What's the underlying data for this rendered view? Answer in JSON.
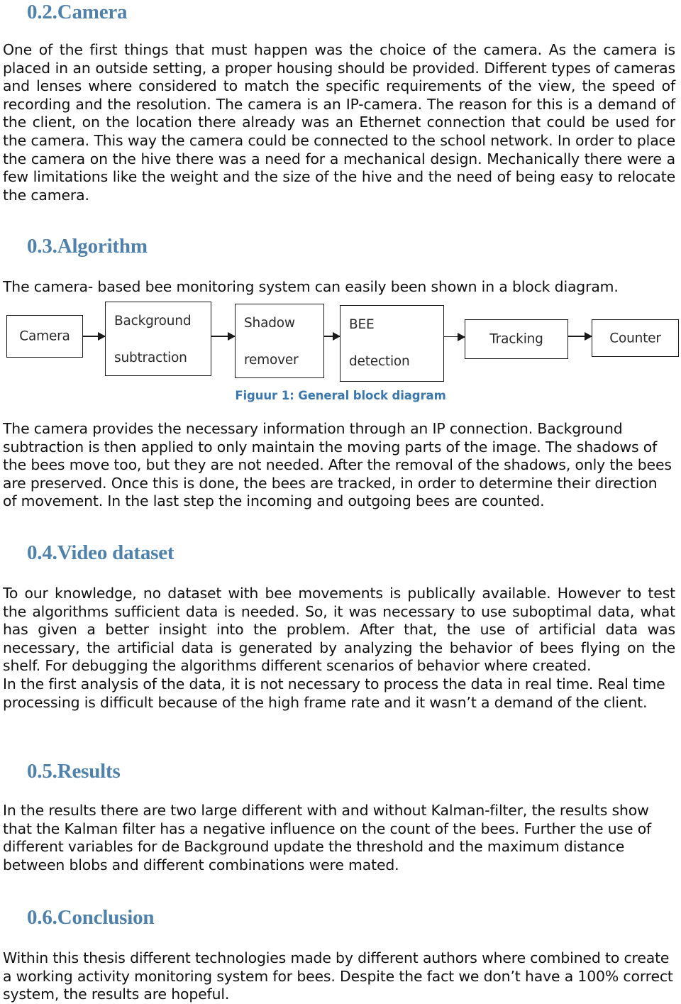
{
  "document": {
    "type": "thesis-report-page",
    "accent_heading_color": "#4f81ab",
    "caption_color": "#3c78ad",
    "body_color": "#111111"
  },
  "sections": [
    {
      "id": "camera",
      "heading": "0.2.Camera",
      "body": "One of the first things that must happen was the choice of the camera. As the camera is placed in an outside setting, a proper housing should be provided. Different types of cameras and lenses where considered to match the specific requirements of the view, the speed of recording and the resolution. The camera is an IP-camera. The reason for this is a demand of the client, on the location there already was an Ethernet connection that could be used for the camera. This way the camera could be connected to the school network. In order to place the camera on the hive there was a need for a mechanical design. Mechanically there were a few limitations like the weight and the size of the hive and the need of being easy to relocate the camera."
    },
    {
      "id": "algorithm",
      "heading": "0.3.Algorithm",
      "intro": "The camera- based bee monitoring system can easily been shown in a block diagram.",
      "body": "The camera provides the necessary information through an IP connection. Background subtraction is then applied to only maintain the moving parts of the image. The shadows of the bees move too, but they are not needed. After the removal of the shadows, only the bees are preserved. Once this is done, the bees are tracked, in order to determine their direction of movement. In the last step the incoming and outgoing bees are counted."
    },
    {
      "id": "video-dataset",
      "heading": "0.4.Video dataset",
      "body": "To our knowledge, no dataset with bee movements is publically available. However to test the algorithms sufficient data is needed. So, it was necessary to use suboptimal data, what has given a better insight into the problem. After that, the use of artificial data was necessary, the artificial data is generated by analyzing the behavior of bees flying on the shelf. For debugging the algorithms different scenarios of behavior where created.",
      "body2": "In the first analysis of the data, it is not necessary to process the data in real time. Real time processing is difficult because of the high frame rate and it wasn’t a demand of the client."
    },
    {
      "id": "results",
      "heading": "0.5.Results",
      "body": "In the results there are two large different with and without Kalman-filter, the results show that the Kalman filter has a negative influence on the count of the bees. Further the use of different variables for de Background update the threshold and the maximum distance between blobs and different combinations were mated."
    },
    {
      "id": "conclusion",
      "heading": "0.6.Conclusion",
      "body": "Within this thesis different technologies made by different authors where combined to create a working activity monitoring system for bees. Despite the fact we don’t have a 100% correct system, the results are hopeful."
    }
  ],
  "figure": {
    "caption": "Figuur 1: General block diagram",
    "blocks": [
      {
        "id": "camera",
        "label": "Camera",
        "line1": "Camera",
        "line2": ""
      },
      {
        "id": "background",
        "label": "Background subtraction",
        "line1": "Background",
        "line2": "subtraction"
      },
      {
        "id": "shadow",
        "label": "Shadow remover",
        "line1": "Shadow",
        "line2": "remover"
      },
      {
        "id": "bee",
        "label": "BEE detection",
        "line1": "BEE",
        "line2": "detection"
      },
      {
        "id": "tracking",
        "label": "Tracking",
        "line1": "Tracking",
        "line2": ""
      },
      {
        "id": "counter",
        "label": "Counter",
        "line1": "Counter",
        "line2": ""
      }
    ]
  }
}
